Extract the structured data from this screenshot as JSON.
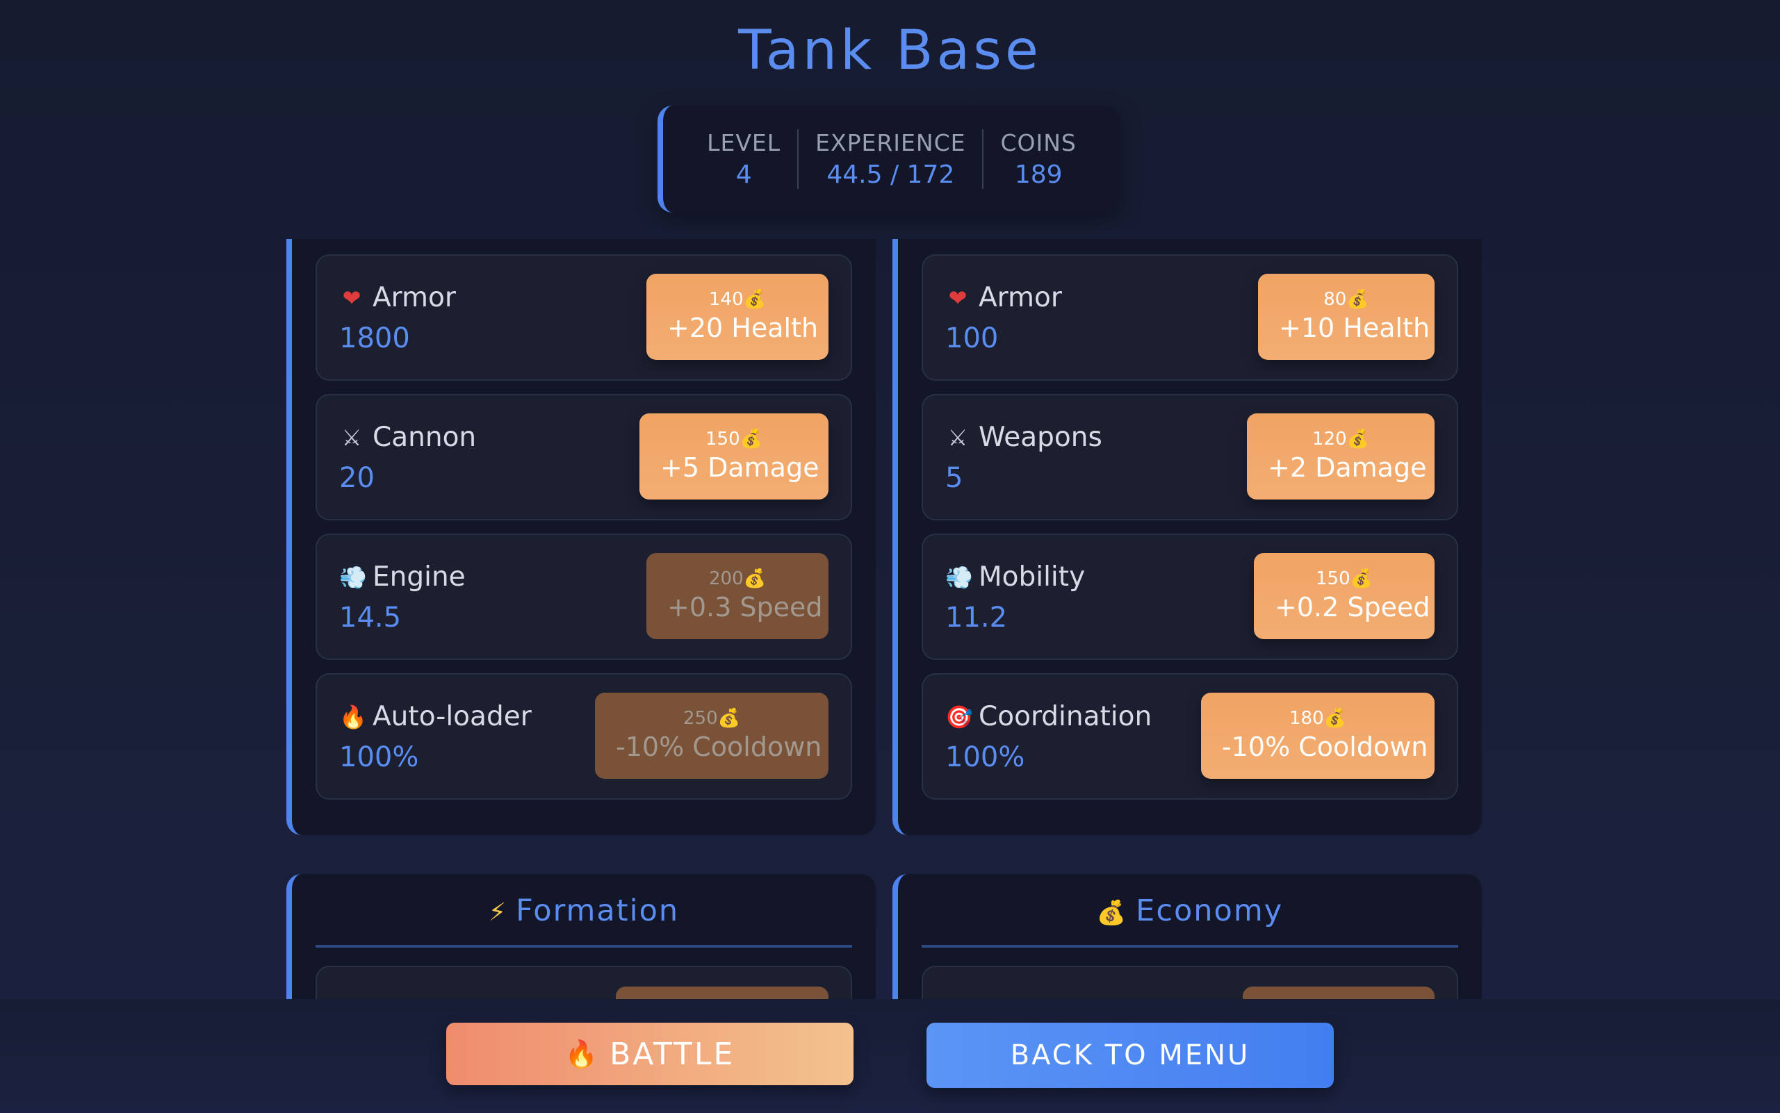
{
  "title": "Tank Base",
  "stats": [
    {
      "label": "LEVEL",
      "value": "4"
    },
    {
      "label": "EXPERIENCE",
      "value": "44.5 / 172"
    },
    {
      "label": "COINS",
      "value": "189"
    }
  ],
  "tank_upgrades": [
    {
      "icon": "heart-icon",
      "glyph": "❤",
      "name": "Armor",
      "value": "1800",
      "cost": "140💰",
      "label": "+20 Health",
      "affordable": true
    },
    {
      "icon": "crossed-swords-icon",
      "glyph": "⚔",
      "name": "Cannon",
      "value": "20",
      "cost": "150💰",
      "label": "+5 Damage",
      "affordable": true
    },
    {
      "icon": "wind-icon",
      "glyph": "💨",
      "name": "Engine",
      "value": "14.5",
      "cost": "200💰",
      "label": "+0.3 Speed",
      "affordable": false
    },
    {
      "icon": "fire-icon",
      "glyph": "🔥",
      "name": "Auto-loader",
      "value": "100%",
      "cost": "250💰",
      "label": "-10% Cooldown",
      "affordable": false
    }
  ],
  "unit_upgrades": [
    {
      "icon": "heart-icon",
      "glyph": "❤",
      "name": "Armor",
      "value": "100",
      "cost": "80💰",
      "label": "+10 Health",
      "affordable": true
    },
    {
      "icon": "crossed-swords-icon",
      "glyph": "⚔",
      "name": "Weapons",
      "value": "5",
      "cost": "120💰",
      "label": "+2 Damage",
      "affordable": true
    },
    {
      "icon": "wind-icon",
      "glyph": "💨",
      "name": "Mobility",
      "value": "11.2",
      "cost": "150💰",
      "label": "+0.2 Speed",
      "affordable": true
    },
    {
      "icon": "target-icon",
      "glyph": "🎯",
      "name": "Coordination",
      "value": "100%",
      "cost": "180💰",
      "label": "-10% Cooldown",
      "affordable": true
    }
  ],
  "sections": {
    "formation": {
      "icon": "lightning-icon",
      "glyph": "⚡",
      "title": "Formation"
    },
    "economy": {
      "icon": "money-bag-icon",
      "glyph": "💰",
      "title": "Economy"
    }
  },
  "buttons": {
    "battle": {
      "icon": "fire-icon",
      "glyph": "🔥",
      "label": "BATTLE"
    },
    "menu": {
      "label": "BACK TO MENU"
    }
  },
  "colors": {
    "accent": "#5b8cf0",
    "upgrade": "#f0a464",
    "upgrade_disabled": "#7a5237"
  }
}
